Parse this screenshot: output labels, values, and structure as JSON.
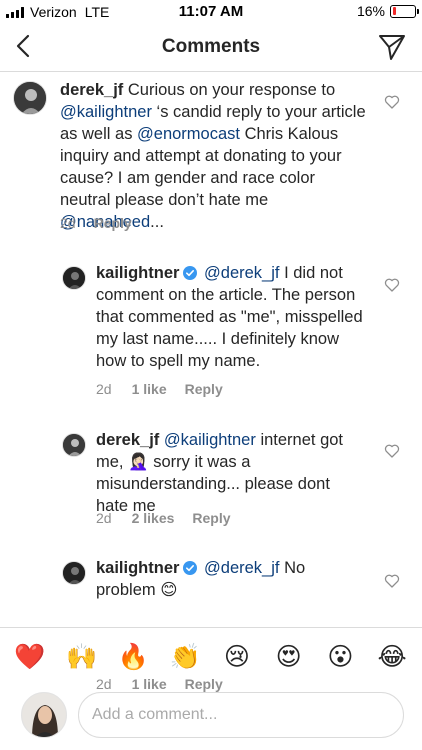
{
  "status_bar": {
    "carrier": "Verizon",
    "network": "LTE",
    "time": "11:07 AM",
    "battery_percent": "16%",
    "battery_level": 0.16,
    "battery_color": "#f02a2a"
  },
  "nav": {
    "title": "Comments",
    "back_icon": "chevron-left-icon",
    "send_icon": "paper-plane-icon"
  },
  "comments": [
    {
      "username": "derek_jf",
      "verified": false,
      "text_parts": [
        {
          "t": "text",
          "v": " Curious on your response to"
        },
        {
          "t": "mention",
          "v": "@kailightner"
        },
        {
          "t": "text",
          "v": " ‘s candid reply to your article as well as "
        },
        {
          "t": "mention",
          "v": "@enormocast"
        },
        {
          "t": "text",
          "v": " Chris Kalous inquiry and attempt at donating to your cause? I am gender and race color neutral please don’t hate me "
        },
        {
          "t": "mention",
          "v": "@nanaheed"
        },
        {
          "t": "text",
          "v": "..."
        }
      ],
      "time": "2d",
      "likes": "",
      "reply": "Reply"
    },
    {
      "username": "kailightner",
      "verified": true,
      "text_parts": [
        {
          "t": "mention",
          "v": "@derek_jf"
        },
        {
          "t": "text",
          "v": " I did not comment on the article.  The person that commented as \"me\", misspelled my last name..... I definitely know how to spell my name."
        }
      ],
      "time": "2d",
      "likes": "1 like",
      "reply": "Reply"
    },
    {
      "username": "derek_jf",
      "verified": false,
      "text_parts": [
        {
          "t": "mention",
          "v": "@kailightner"
        },
        {
          "t": "text",
          "v": " internet got me, 🤦🏻‍♀️ sorry it was a misunderstanding... please dont hate me"
        }
      ],
      "time": "2d",
      "likes": "2 likes",
      "reply": "Reply"
    },
    {
      "username": "kailightner",
      "verified": true,
      "text_parts": [
        {
          "t": "mention",
          "v": "@derek_jf"
        },
        {
          "t": "text",
          "v": " No problem 😊"
        }
      ],
      "time": "2d",
      "likes": "1 like",
      "reply": "Reply"
    }
  ],
  "emoji_bar": [
    "❤️",
    "🙌",
    "🔥",
    "👏",
    "😢",
    "😍",
    "😮",
    "😂"
  ],
  "input": {
    "placeholder": "Add a comment..."
  },
  "colors": {
    "mention": "#0d3e7a",
    "muted": "#8e8e8e",
    "verified": "#3897f0"
  }
}
